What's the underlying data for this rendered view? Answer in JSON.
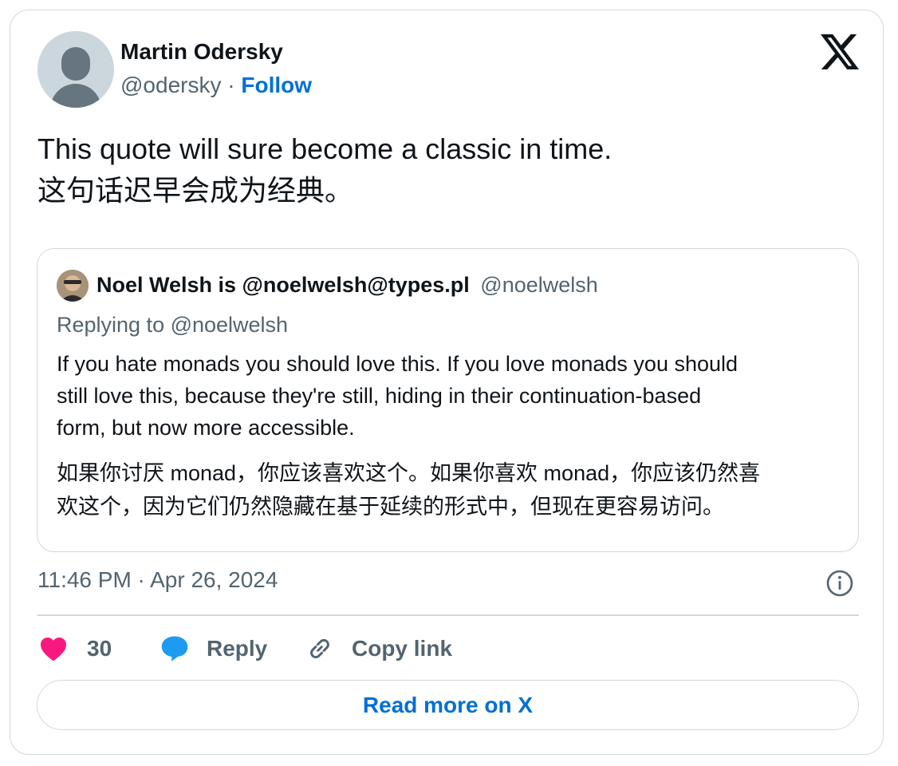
{
  "author": {
    "name": "Martin Odersky",
    "handle": "@odersky",
    "separator": "·",
    "follow_label": "Follow"
  },
  "tweet": {
    "lines": [
      "This quote will sure become a classic in time.",
      "这句话迟早会成为经典。"
    ]
  },
  "quoted_tweet": {
    "author_name": "Noel Welsh is @noelwelsh@types.pl",
    "author_handle": "@noelwelsh",
    "replying_to": "Replying to @noelwelsh",
    "body_lines": [
      "If you hate monads you should love this. If you love monads you should",
      "still love this, because they're still, hiding in their continuation-based",
      "form, but now more accessible."
    ],
    "body_zh_lines": [
      "如果你讨厌 monad，你应该喜欢这个。如果你喜欢 monad，你应该仍然喜",
      "欢这个，因为它们仍然隐藏在基于延续的形式中，但现在更容易访问。"
    ]
  },
  "timestamp": "11:46 PM · Apr 26, 2024",
  "actions": {
    "like_count": "30",
    "reply_label": "Reply",
    "copy_link_label": "Copy link"
  },
  "read_more_label": "Read more on X",
  "colors": {
    "link": "#006fd6",
    "heart": "#f91880",
    "reply_bubble": "#1d9bf0",
    "muted_text": "#536471",
    "border": "#cfd9de"
  },
  "icons": {
    "brand": "x-logo-icon",
    "info": "info-icon",
    "like": "heart-icon",
    "reply": "speech-bubble-icon",
    "copy": "link-icon"
  }
}
